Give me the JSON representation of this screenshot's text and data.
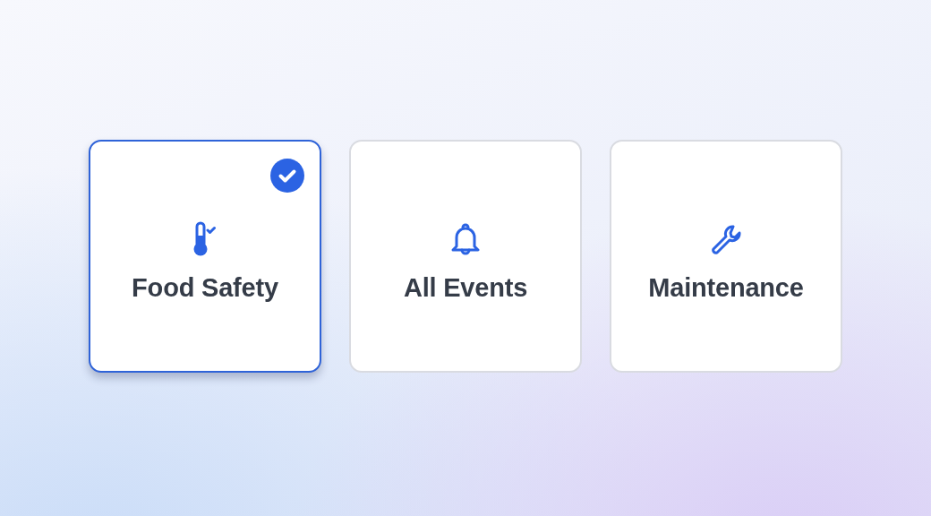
{
  "cards": [
    {
      "kind": "thermometer",
      "label": "Food Safety",
      "selected": true
    },
    {
      "kind": "bell",
      "label": "All Events",
      "selected": false
    },
    {
      "kind": "wrench",
      "label": "Maintenance",
      "selected": false
    }
  ]
}
